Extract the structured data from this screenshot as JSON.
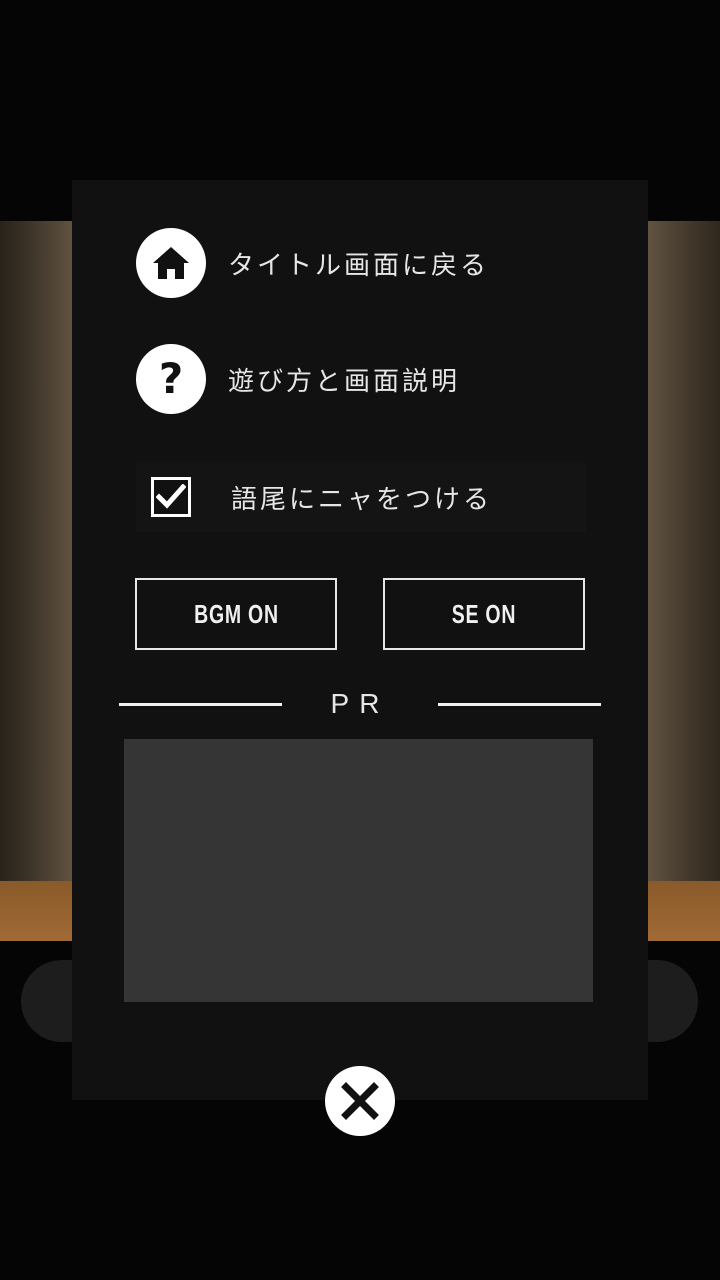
{
  "menu": {
    "home_label": "タイトル画面に戻る",
    "help_label": "遊び方と画面説明",
    "help_icon_glyph": "?",
    "nya_label": "語尾にニャをつける",
    "nya_checked": true
  },
  "audio": {
    "bgm_label": "BGM ON",
    "se_label": "SE ON"
  },
  "pr": {
    "label": "PR"
  },
  "icons": {
    "home": "home-icon",
    "help": "question-icon",
    "check": "check-icon",
    "close": "close-icon"
  },
  "colors": {
    "panel": "#111111",
    "ad_placeholder": "#353535",
    "text": "#e6e6e6",
    "icon_bg": "#ffffff"
  }
}
